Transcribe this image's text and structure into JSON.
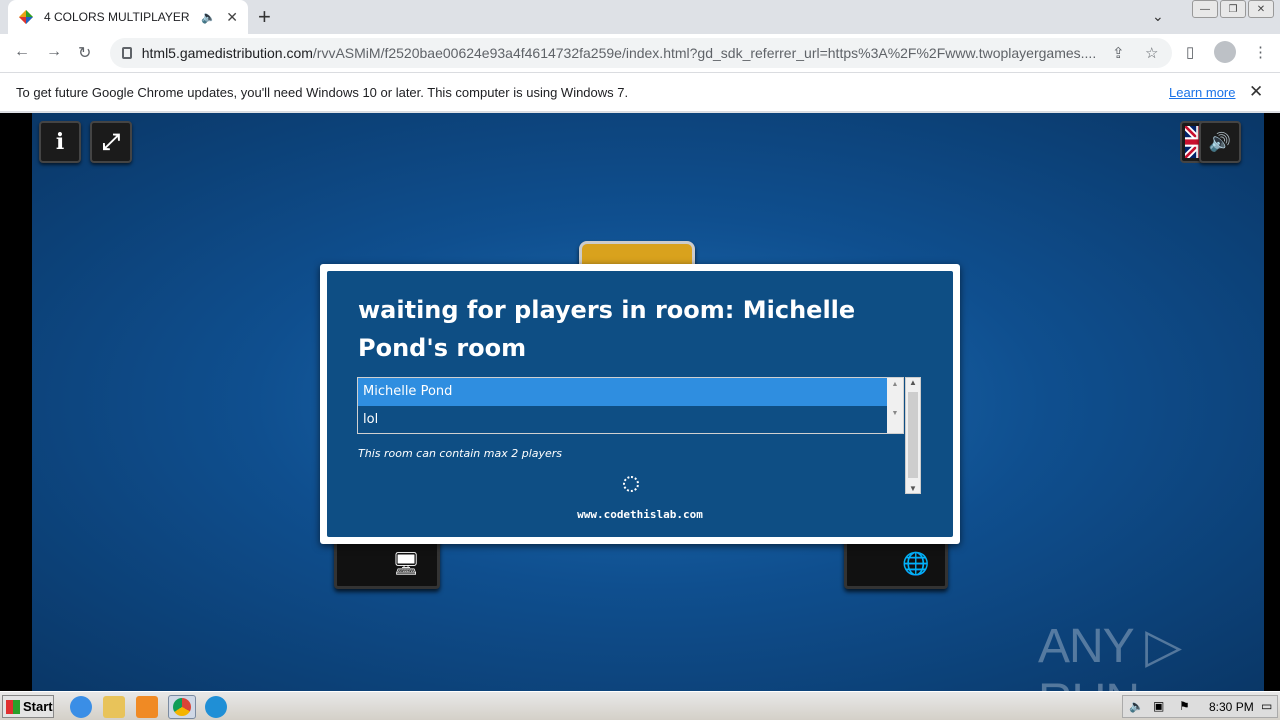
{
  "browser": {
    "tab_title": "4 COLORS MULTIPLAYER",
    "url_host": "html5.gamedistribution.com",
    "url_rest": "/rvvASMiM/f2520bae00624e93a4f4614732fa259e/index.html?gd_sdk_referrer_url=https%3A%2F%2Fwww.twoplayergames....",
    "new_tab": "+",
    "tab_close": "✕"
  },
  "infobar": {
    "message": "To get future Google Chrome updates, you'll need Windows 10 or later. This computer is using Windows 7.",
    "link": "Learn more",
    "close": "✕"
  },
  "game": {
    "info_btn": "i",
    "fullscreen_btn": "⤢",
    "sound_btn": "🔊",
    "dialog_title": "waiting for players in room: Michelle Pond's room",
    "players": [
      "Michelle Pond",
      "lol"
    ],
    "max_note": "This room can contain max 2 players",
    "site": "www.codethislab.com"
  },
  "watermark": "ANY ▷ RUN",
  "taskbar": {
    "start": "Start",
    "clock": "8:30 PM"
  }
}
